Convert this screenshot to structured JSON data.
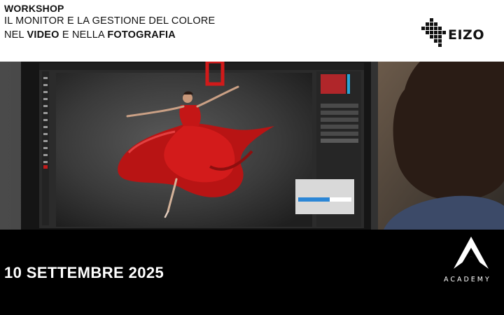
{
  "header": {
    "line1": "WORKSHOP",
    "line2": "IL MONITOR E LA GESTIONE DEL COLORE",
    "line3_pre": "NEL ",
    "line3_bold1": "VIDEO",
    "line3_mid": " E NELLA ",
    "line3_bold2": "FOTOGRAFIA"
  },
  "brand": {
    "logo_text": "EIZO",
    "logo_icon": "eizo-grid-icon"
  },
  "footer": {
    "date": "10 SETTEMBRE 2025",
    "academy": "ACADEMY",
    "academy_icon": "academy-peak-icon"
  },
  "colors": {
    "header_bg": "#ffffff",
    "footer_bg": "#000000",
    "text_dark": "#111111",
    "text_light": "#ffffff",
    "accent_red": "#d11a1a"
  }
}
